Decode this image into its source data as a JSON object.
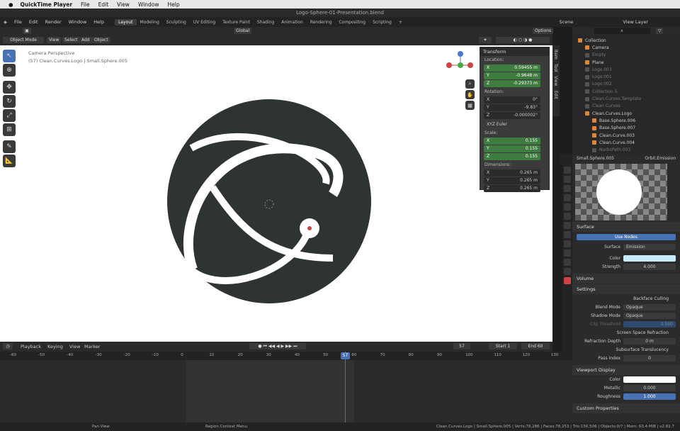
{
  "mac": {
    "app": "QuickTime Player",
    "menus": [
      "File",
      "Edit",
      "View",
      "Window",
      "Help"
    ]
  },
  "window_title": "Logo-Sphere-01-Presentation.blend",
  "blender_menus": [
    "File",
    "Edit",
    "Render",
    "Window",
    "Help"
  ],
  "workspaces": [
    "Layout",
    "Modeling",
    "Sculpting",
    "UV Editing",
    "Texture Paint",
    "Shading",
    "Animation",
    "Rendering",
    "Compositing",
    "Scripting"
  ],
  "scene": "Scene",
  "view_layer": "View Layer",
  "header": {
    "mode": "Object Mode",
    "view": "View",
    "select": "Select",
    "add": "Add",
    "object": "Object",
    "orientation": "Global",
    "options": "Options"
  },
  "viewport": {
    "line1": "Camera Perspective",
    "line2": "(57) Clean.Curves.Logo | Small.Sphere.005"
  },
  "npanel": {
    "title": "Transform",
    "location_label": "Location:",
    "loc": [
      "0.59455 m",
      "-0.9648 m",
      "-0.29373 m"
    ],
    "rotation_label": "Rotation:",
    "rot": [
      "0°",
      "-9.83°",
      "-0.000002°"
    ],
    "euler": "XYZ Euler",
    "scale_label": "Scale:",
    "scale": [
      "0.155",
      "0.155",
      "0.155"
    ],
    "dimensions_label": "Dimensions:",
    "dim": [
      "0.265 m",
      "0.265 m",
      "0.265 m"
    ],
    "axes": [
      "X",
      "Y",
      "Z"
    ],
    "tabs": [
      "Item",
      "Tool",
      "View",
      "Edit"
    ]
  },
  "outliner": [
    {
      "name": "Collection",
      "dim": false,
      "indent": 0
    },
    {
      "name": "Camera",
      "dim": false,
      "indent": 1
    },
    {
      "name": "Empty",
      "dim": true,
      "indent": 1
    },
    {
      "name": "Plane",
      "dim": false,
      "indent": 1
    },
    {
      "name": "Logo.003",
      "dim": true,
      "indent": 1
    },
    {
      "name": "Logo.001",
      "dim": true,
      "indent": 1
    },
    {
      "name": "Logo.002",
      "dim": true,
      "indent": 1
    },
    {
      "name": "Collection 5",
      "dim": true,
      "indent": 1
    },
    {
      "name": "Clean.Curves.Template",
      "dim": true,
      "indent": 1
    },
    {
      "name": "Clean Curves",
      "dim": true,
      "indent": 1
    },
    {
      "name": "Clean.Curves.Logo",
      "dim": false,
      "indent": 1
    },
    {
      "name": "Base.Sphere.006",
      "dim": false,
      "indent": 2
    },
    {
      "name": "Base.Sphere.007",
      "dim": false,
      "indent": 2
    },
    {
      "name": "Clean.Curve.003",
      "dim": false,
      "indent": 2
    },
    {
      "name": "Clean.Curve.004",
      "dim": false,
      "indent": 2
    },
    {
      "name": "NurbsPath.003",
      "dim": true,
      "indent": 2
    }
  ],
  "props": {
    "object": "Small.Sphere.005",
    "material": "Orbit.Emission",
    "surface": "Surface",
    "use_nodes": "Use Nodes",
    "surface_label": "Surface",
    "surface_val": "Emission",
    "color_label": "Color",
    "strength_label": "Strength",
    "strength": "4.000",
    "volume": "Volume",
    "settings": "Settings",
    "backface": "Backface Culling",
    "blend_label": "Blend Mode",
    "blend": "Opaque",
    "shadow_label": "Shadow Mode",
    "shadow": "Opaque",
    "clip_label": "Clip Threshold",
    "clip": "0.500",
    "ssr": "Screen Space Refraction",
    "refr_label": "Refraction Depth",
    "refr": "0 m",
    "sss": "Subsurface Translucency",
    "pass_label": "Pass Index",
    "pass": "0",
    "vpd": "Viewport Display",
    "vcolor": "Color",
    "metal_label": "Metallic",
    "metal": "0.000",
    "rough_label": "Roughness",
    "rough": "1.000",
    "custom": "Custom Properties"
  },
  "timeline": {
    "menus": [
      "Playback",
      "Keying",
      "View",
      "Marker"
    ],
    "frame": "57",
    "start_label": "Start",
    "start": "1",
    "end_label": "End",
    "end": "60",
    "ticks": [
      "-60",
      "-50",
      "-40",
      "-30",
      "-20",
      "-10",
      "0",
      "10",
      "20",
      "30",
      "40",
      "50",
      "60",
      "70",
      "80",
      "90",
      "100",
      "110",
      "120",
      "130"
    ]
  },
  "status": {
    "left": "Pan View",
    "mid": "Region Context Menu",
    "right": "Clean.Curves.Logo | Small.Sphere.005 | Verts:78,286 | Faces:78,253 | Tris:156,506 | Objects:0/7 | Mem: 63.4 MiB | v2.82.7"
  },
  "colors": {
    "sphere": "#2e3531",
    "green_field": "#3f7c3f",
    "accent": "#4772b3"
  }
}
